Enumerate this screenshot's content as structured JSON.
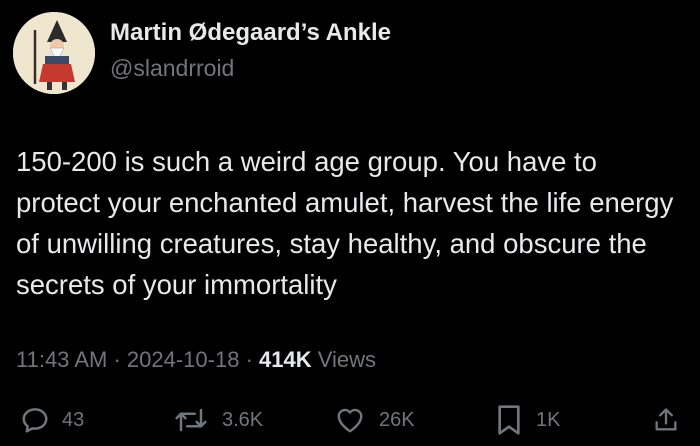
{
  "author": {
    "display_name": "Martin Ødegaard’s Ankle",
    "handle": "@slandrroid",
    "avatar_icon": "gnome-figure-avatar"
  },
  "tweet": {
    "text": "150-200 is such a weird age group. You have to protect your enchanted amulet, harvest the life energy of unwilling creatures, stay healthy, and obscure the secrets of your immortality"
  },
  "meta": {
    "time": "11:43 AM",
    "separator1": "·",
    "date": "2024-10-18",
    "separator2": "·",
    "views_count": "414K",
    "views_label": "Views"
  },
  "actions": {
    "reply": {
      "icon": "reply-icon",
      "count": "43"
    },
    "repost": {
      "icon": "repost-icon",
      "count": "3.6K"
    },
    "like": {
      "icon": "heart-icon",
      "count": "26K"
    },
    "bookmark": {
      "icon": "bookmark-icon",
      "count": "1K"
    },
    "share": {
      "icon": "share-icon"
    }
  },
  "colors": {
    "background": "#000000",
    "primary_text": "#e7e9ea",
    "secondary_text": "#71767b"
  }
}
